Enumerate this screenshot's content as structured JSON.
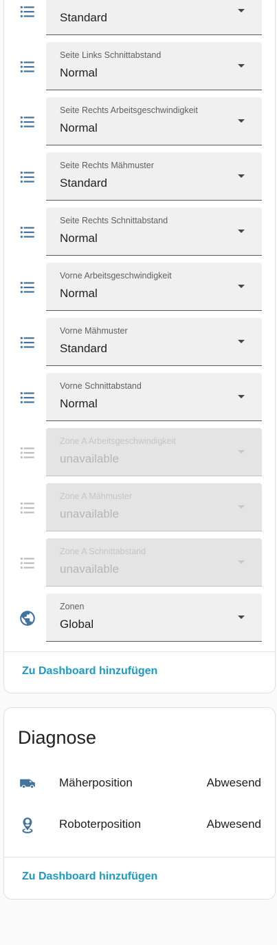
{
  "colors": {
    "icon": "#44739e",
    "icon_disabled": "#bdbdbd",
    "link": "#1a9bc2"
  },
  "controls": {
    "selects": [
      {
        "label": "",
        "value": "Standard",
        "icon": "format-list-bulleted-icon",
        "disabled": false
      },
      {
        "label": "Seite Links Schnittabstand",
        "value": "Normal",
        "icon": "format-list-bulleted-icon",
        "disabled": false
      },
      {
        "label": "Seite Rechts Arbeitsgeschwindigkeit",
        "value": "Normal",
        "icon": "format-list-bulleted-icon",
        "disabled": false
      },
      {
        "label": "Seite Rechts Mähmuster",
        "value": "Standard",
        "icon": "format-list-bulleted-icon",
        "disabled": false
      },
      {
        "label": "Seite Rechts Schnittabstand",
        "value": "Normal",
        "icon": "format-list-bulleted-icon",
        "disabled": false
      },
      {
        "label": "Vorne Arbeitsgeschwindigkeit",
        "value": "Normal",
        "icon": "format-list-bulleted-icon",
        "disabled": false
      },
      {
        "label": "Vorne Mähmuster",
        "value": "Standard",
        "icon": "format-list-bulleted-icon",
        "disabled": false
      },
      {
        "label": "Vorne Schnittabstand",
        "value": "Normal",
        "icon": "format-list-bulleted-icon",
        "disabled": false
      },
      {
        "label": "Zone A Arbeitsgeschwindigkeit",
        "value": "unavailable",
        "icon": "format-list-bulleted-icon",
        "disabled": true
      },
      {
        "label": "Zone A Mähmuster",
        "value": "unavailable",
        "icon": "format-list-bulleted-icon",
        "disabled": true
      },
      {
        "label": "Zone A Schnittabstand",
        "value": "unavailable",
        "icon": "format-list-bulleted-icon",
        "disabled": true
      },
      {
        "label": "Zonen",
        "value": "Global",
        "icon": "earth-icon",
        "disabled": false
      }
    ],
    "add_to_dashboard": "Zu Dashboard hinzufügen"
  },
  "diagnose": {
    "title": "Diagnose",
    "rows": [
      {
        "name": "Mäherposition",
        "state": "Abwesend",
        "icon": "van-icon"
      },
      {
        "name": "Roboterposition",
        "state": "Abwesend",
        "icon": "map-marker-account-icon"
      }
    ],
    "add_to_dashboard": "Zu Dashboard hinzufügen"
  }
}
